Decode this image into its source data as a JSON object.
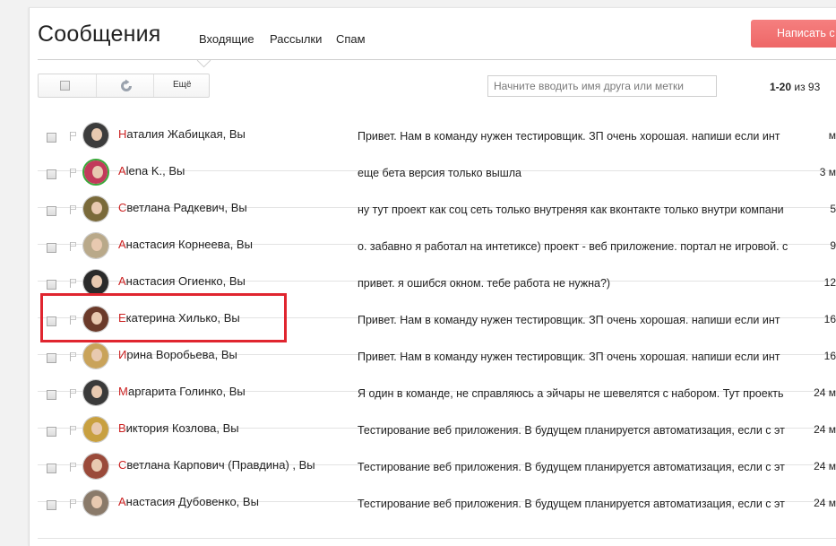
{
  "header": {
    "title": "Сообщения",
    "tabs": [
      "Входящие",
      "Рассылки",
      "Спам"
    ],
    "compose_label": "Написать с"
  },
  "toolbar": {
    "more_label": "Ещё",
    "search_placeholder": "Начните вводить имя друга или метки",
    "pager_range": "1-20",
    "pager_of": "из 93"
  },
  "messages": [
    {
      "initial": "Н",
      "sender_rest": "аталия Жабицкая, Вы",
      "snippet": "Привет. Нам в команду нужен тестировщик. ЗП очень хорошая. напиши если инт",
      "date": "м",
      "avatar_color": "#3c3c3c"
    },
    {
      "initial": "A",
      "sender_rest": "lena K., Вы",
      "snippet": "еще бета версия только вышла",
      "date": "3 м",
      "avatar_color": "#c23a5a"
    },
    {
      "initial": "С",
      "sender_rest": "ветлана Радкевич, Вы",
      "snippet": "ну тут проект как соц сеть только внутреняя как вконтакте только внутри компани",
      "date": "5",
      "avatar_color": "#7a6a3a"
    },
    {
      "initial": "А",
      "sender_rest": "настасия Корнеева, Вы",
      "snippet": "о. забавно я работал на интетиксе) проект - веб приложение. портал не игровой. с",
      "date": "9",
      "avatar_color": "#b9a98a"
    },
    {
      "initial": "А",
      "sender_rest": "настасия Огиенко, Вы",
      "snippet": "привет. я ошибся окном. тебе работа не нужна?)",
      "date": "12",
      "avatar_color": "#2a2a2a"
    },
    {
      "initial": "Е",
      "sender_rest": "катерина Хилько, Вы",
      "snippet": "Привет. Нам в команду нужен тестировщик. ЗП очень хорошая. напиши если инт",
      "date": "16",
      "avatar_color": "#6b3a2a"
    },
    {
      "initial": "И",
      "sender_rest": "рина Воробьева, Вы",
      "snippet": "Привет. Нам в команду нужен тестировщик. ЗП очень хорошая. напиши если инт",
      "date": "16",
      "avatar_color": "#c9a35a"
    },
    {
      "initial": "М",
      "sender_rest": "аргарита Голинко, Вы",
      "snippet": "Я один в команде, не справляюсь а эйчары не шевелятся с набором. Тут проекть",
      "date": "24 м",
      "avatar_color": "#3a3a3a"
    },
    {
      "initial": "В",
      "sender_rest": "иктория Козлова, Вы",
      "snippet": "Тестирование веб приложения. В будущем планируется автоматизация, если с эт",
      "date": "24 м",
      "avatar_color": "#c8a040"
    },
    {
      "initial": "С",
      "sender_rest": "ветлана Карпович (Правдина) , Вы",
      "snippet": "Тестирование веб приложения. В будущем планируется автоматизация, если с эт",
      "date": "24 м",
      "avatar_color": "#9a4a3a"
    },
    {
      "initial": "А",
      "sender_rest": "настасия Дубовенко, Вы",
      "snippet": "Тестирование веб приложения. В будущем планируется автоматизация, если с эт",
      "date": "24 м",
      "avatar_color": "#8a7a6a"
    }
  ],
  "colors": {
    "compose_bg": "#ee6767",
    "sender_initial": "#cc2222",
    "highlight_box": "#e0252f"
  }
}
